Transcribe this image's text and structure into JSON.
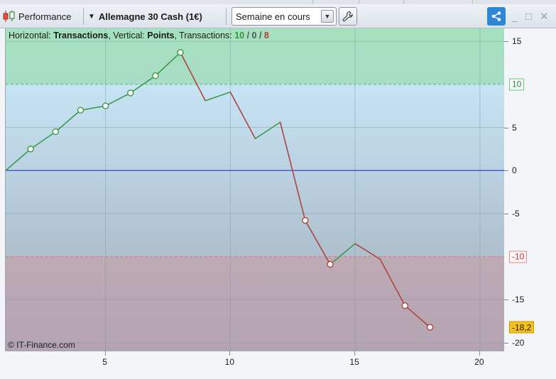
{
  "toolbar": {
    "performance_label": "Performance",
    "instrument_label": "Allemagne 30 Cash (1€)",
    "period_value": "Semaine en cours"
  },
  "chart_header": {
    "horizontal_prefix": "Horizontal: ",
    "horizontal_value": "Transactions",
    "vertical_prefix": ", Vertical: ",
    "vertical_value": "Points",
    "transactions_prefix": ", Transactions: ",
    "count_winning": "10",
    "count_neutral": "0",
    "count_losing": "8",
    "slash": " / "
  },
  "copyright": "© IT-Finance.com",
  "y_axis": {
    "labels": [
      {
        "value": 15,
        "text": "15"
      },
      {
        "value": 5,
        "text": "5"
      },
      {
        "value": 0,
        "text": "0"
      },
      {
        "value": -5,
        "text": "-5"
      },
      {
        "value": -15,
        "text": "-15"
      },
      {
        "value": -20,
        "text": "-20"
      }
    ],
    "upper_threshold_label": "10",
    "lower_threshold_label": "-10",
    "last_value_label": "-18,2"
  },
  "x_axis": {
    "labels": [
      {
        "value": 5,
        "text": "5"
      },
      {
        "value": 10,
        "text": "10"
      },
      {
        "value": 15,
        "text": "15"
      },
      {
        "value": 20,
        "text": "20"
      }
    ]
  },
  "colors": {
    "gain_line": "#3c9a4a",
    "loss_line": "#b2443f",
    "zero_line": "#2b2fc9",
    "upper_zone": "#a6e0be",
    "lower_zone": "#b9a7b3",
    "share_button": "#2e86d6"
  },
  "chart_data": {
    "type": "line",
    "title": "",
    "xlabel": "Transactions",
    "ylabel": "Points",
    "xlim": [
      1,
      21
    ],
    "ylim": [
      -21,
      16.5
    ],
    "upper_threshold": 10,
    "lower_threshold": -10,
    "zero_line": 0,
    "grid": true,
    "series": [
      {
        "name": "",
        "x": [
          1,
          2,
          3,
          4,
          5,
          6,
          7,
          8,
          9,
          10,
          11,
          12,
          13,
          14,
          15,
          16,
          17,
          18
        ],
        "y": [
          0,
          2.5,
          4.5,
          7,
          7.5,
          9,
          11,
          13.7,
          8.1,
          9.1,
          3.7,
          5.6,
          -5.8,
          -10.9,
          -8.5,
          -10.3,
          -15.7,
          -18.2
        ],
        "markers": [
          false,
          true,
          true,
          true,
          true,
          true,
          true,
          true,
          false,
          false,
          false,
          false,
          true,
          true,
          false,
          false,
          true,
          true
        ]
      }
    ]
  }
}
